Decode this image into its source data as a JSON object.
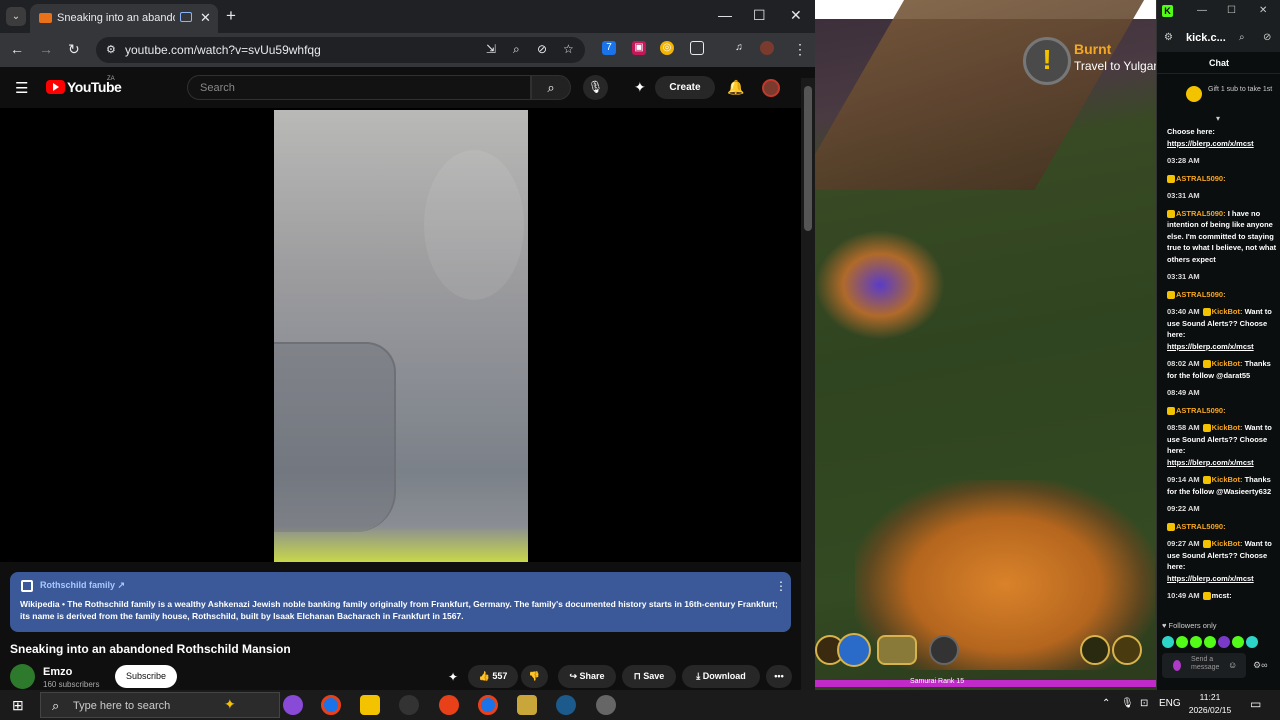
{
  "browser": {
    "tab_title": "Sneaking into an abandoned",
    "url": "youtube.com/watch?v=svUu59whfqg"
  },
  "youtube": {
    "logo_word": "YouTube",
    "country": "ZA",
    "search_placeholder": "Search",
    "create_label": "Create"
  },
  "wiki": {
    "title": "Rothschild family ↗",
    "text": "Wikipedia • The Rothschild family is a wealthy Ashkenazi Jewish noble banking family originally from Frankfurt, Germany. The family's documented history starts in 16th-century Frankfurt; its name is derived from the family house, Rothschild, built by Isaak Elchanan Bacharach in Frankfurt in 1567."
  },
  "video": {
    "title": "Sneaking into an abandoned Rothschild Mansion",
    "channel": "Emzo",
    "subscribers": "160 subscribers",
    "subscribe_label": "Subscribe",
    "likes": "557",
    "share_label": "Share",
    "save_label": "Save",
    "download_label": "Download"
  },
  "game": {
    "quest_title": "Burnt",
    "quest_sub": "Travel to Yulgar",
    "rank_label": "Samurai Rank 15"
  },
  "kick": {
    "url": "kick.c...",
    "chat_label": "Chat",
    "gift_text": "Gift 1 sub to take 1st",
    "followers_only": "Followers only",
    "send_placeholder": "Send a message",
    "messages": [
      {
        "time": "",
        "user": "",
        "text": "Choose here:",
        "link": "https://blerp.com/x/mcst",
        "ucolor": "#fff"
      },
      {
        "time": "03:28 AM",
        "user": "",
        "text": "",
        "link": "",
        "ucolor": "#fff"
      },
      {
        "time": "",
        "user": "ASTRAL5090:",
        "text": "",
        "link": "",
        "ucolor": "#f5a623"
      },
      {
        "time": "03:31 AM",
        "user": "",
        "text": "",
        "link": "",
        "ucolor": "#fff"
      },
      {
        "time": "",
        "user": "ASTRAL5090:",
        "text": "I have no intention of being like anyone else. I'm committed to staying true to what I believe, not what others expect",
        "link": "",
        "ucolor": "#f5a623"
      },
      {
        "time": "03:31 AM",
        "user": "",
        "text": "",
        "link": "",
        "ucolor": "#fff"
      },
      {
        "time": "",
        "user": "ASTRAL5090:",
        "text": "",
        "link": "",
        "ucolor": "#f5a623"
      },
      {
        "time": "03:40 AM",
        "user": "KickBot:",
        "text": "Want to use Sound Alerts?? Choose here:",
        "link": "https://blerp.com/x/mcst",
        "ucolor": "#f5a623"
      },
      {
        "time": "08:02 AM",
        "user": "KickBot:",
        "text": "Thanks for the follow @darat55",
        "link": "",
        "ucolor": "#f5a623"
      },
      {
        "time": "08:49 AM",
        "user": "",
        "text": "",
        "link": "",
        "ucolor": "#fff"
      },
      {
        "time": "",
        "user": "ASTRAL5090:",
        "text": "",
        "link": "",
        "ucolor": "#f5a623"
      },
      {
        "time": "08:58 AM",
        "user": "KickBot:",
        "text": "Want to use Sound Alerts?? Choose here:",
        "link": "https://blerp.com/x/mcst",
        "ucolor": "#f5a623"
      },
      {
        "time": "09:14 AM",
        "user": "KickBot:",
        "text": "Thanks for the follow @Wasieerty632",
        "link": "",
        "ucolor": "#f5a623"
      },
      {
        "time": "09:22 AM",
        "user": "",
        "text": "",
        "link": "",
        "ucolor": "#fff"
      },
      {
        "time": "",
        "user": "ASTRAL5090:",
        "text": "",
        "link": "",
        "ucolor": "#f5a623"
      },
      {
        "time": "09:27 AM",
        "user": "KickBot:",
        "text": "Want to use Sound Alerts?? Choose here:",
        "link": "https://blerp.com/x/mcst",
        "ucolor": "#f5a623"
      },
      {
        "time": "10:49 AM",
        "user": "mcst:",
        "text": "",
        "link": "",
        "ucolor": "#fff"
      }
    ]
  },
  "taskbar": {
    "search_placeholder": "Type here to search",
    "lang": "ENG",
    "time": "11:21",
    "date": "2026/02/15"
  },
  "colors": {
    "youtube_red": "#ff0000",
    "kick_green": "#53fc18",
    "wiki_blue": "#3b5998",
    "username_orange": "#f5a623"
  }
}
